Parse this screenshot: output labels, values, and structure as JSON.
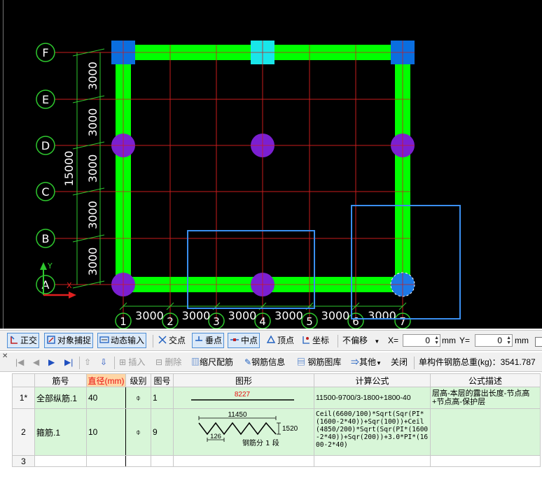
{
  "drawing": {
    "axes_rows": [
      "F",
      "E",
      "D",
      "C",
      "B",
      "A"
    ],
    "axes_cols": [
      "1",
      "2",
      "3",
      "4",
      "5",
      "6",
      "7"
    ],
    "row_dims": [
      "3000",
      "3000",
      "3000",
      "3000",
      "3000"
    ],
    "row_total": "15000",
    "col_dims": [
      "3000",
      "3000",
      "3000",
      "3000",
      "3000",
      "3000"
    ],
    "ucs_x": "X",
    "ucs_y": "Y",
    "colors": {
      "background": "#000000",
      "beam": "#00ff00",
      "grid": "#c81e1e",
      "column": "#7b1fd1",
      "column_selected": "#1e78e6",
      "corner": "#0a6ee0",
      "corner_cyan": "#19e6ea",
      "selection": "#3a8ff0",
      "axis_circle": "#2ec82e"
    }
  },
  "toolbar1": {
    "ortho": "正交",
    "snap": "对象捕捉",
    "dynamic": "动态输入",
    "intersect": "交点",
    "perp": "垂点",
    "mid": "中点",
    "vertex": "顶点",
    "coord": "坐标",
    "offset": "不偏移",
    "x_label": "X=",
    "x_value": "0",
    "x_unit": "mm",
    "y_label": "Y=",
    "y_value": "0",
    "y_unit": "mm"
  },
  "toolbar2": {
    "insert": "插入",
    "delete": "删除",
    "scale": "缩尺配筋",
    "info": "钢筋信息",
    "library": "钢筋图库",
    "other": "其他",
    "close": "关闭",
    "total": "单构件钢筋总重(kg)：3541.787"
  },
  "table": {
    "headers": [
      "筋号",
      "直径(mm)",
      "级别",
      "图号",
      "图形",
      "计算公式",
      "公式描述"
    ],
    "rows": [
      {
        "no": "1*",
        "name": "全部纵筋.1",
        "dia": "40",
        "grade": "⌽",
        "fig": "1",
        "shape_value": "8227",
        "formula": "11500-9700/3-1800+1800-40",
        "desc": "层高-本层的露出长度-节点高+节点高-保护层"
      },
      {
        "no": "2",
        "name": "箍筋.1",
        "dia": "10",
        "grade": "⌽",
        "fig": "9",
        "shape_value": "11450",
        "shape_height": "1520",
        "shape_pitch": "126",
        "shape_note": "钢筋分 1 段",
        "formula": "Ceil(6600/100)*Sqrt(Sqr(PI*(1600-2*40))+Sqr(100))+Ceil(4850/200)*Sqrt(Sqr(PI*(1600-2*40))+Sqr(200))+3.0*PI*(1600-2*40)",
        "desc": ""
      },
      {
        "no": "3",
        "name": "",
        "dia": "",
        "grade": "",
        "fig": "",
        "shape_value": "",
        "formula": "",
        "desc": ""
      }
    ]
  }
}
